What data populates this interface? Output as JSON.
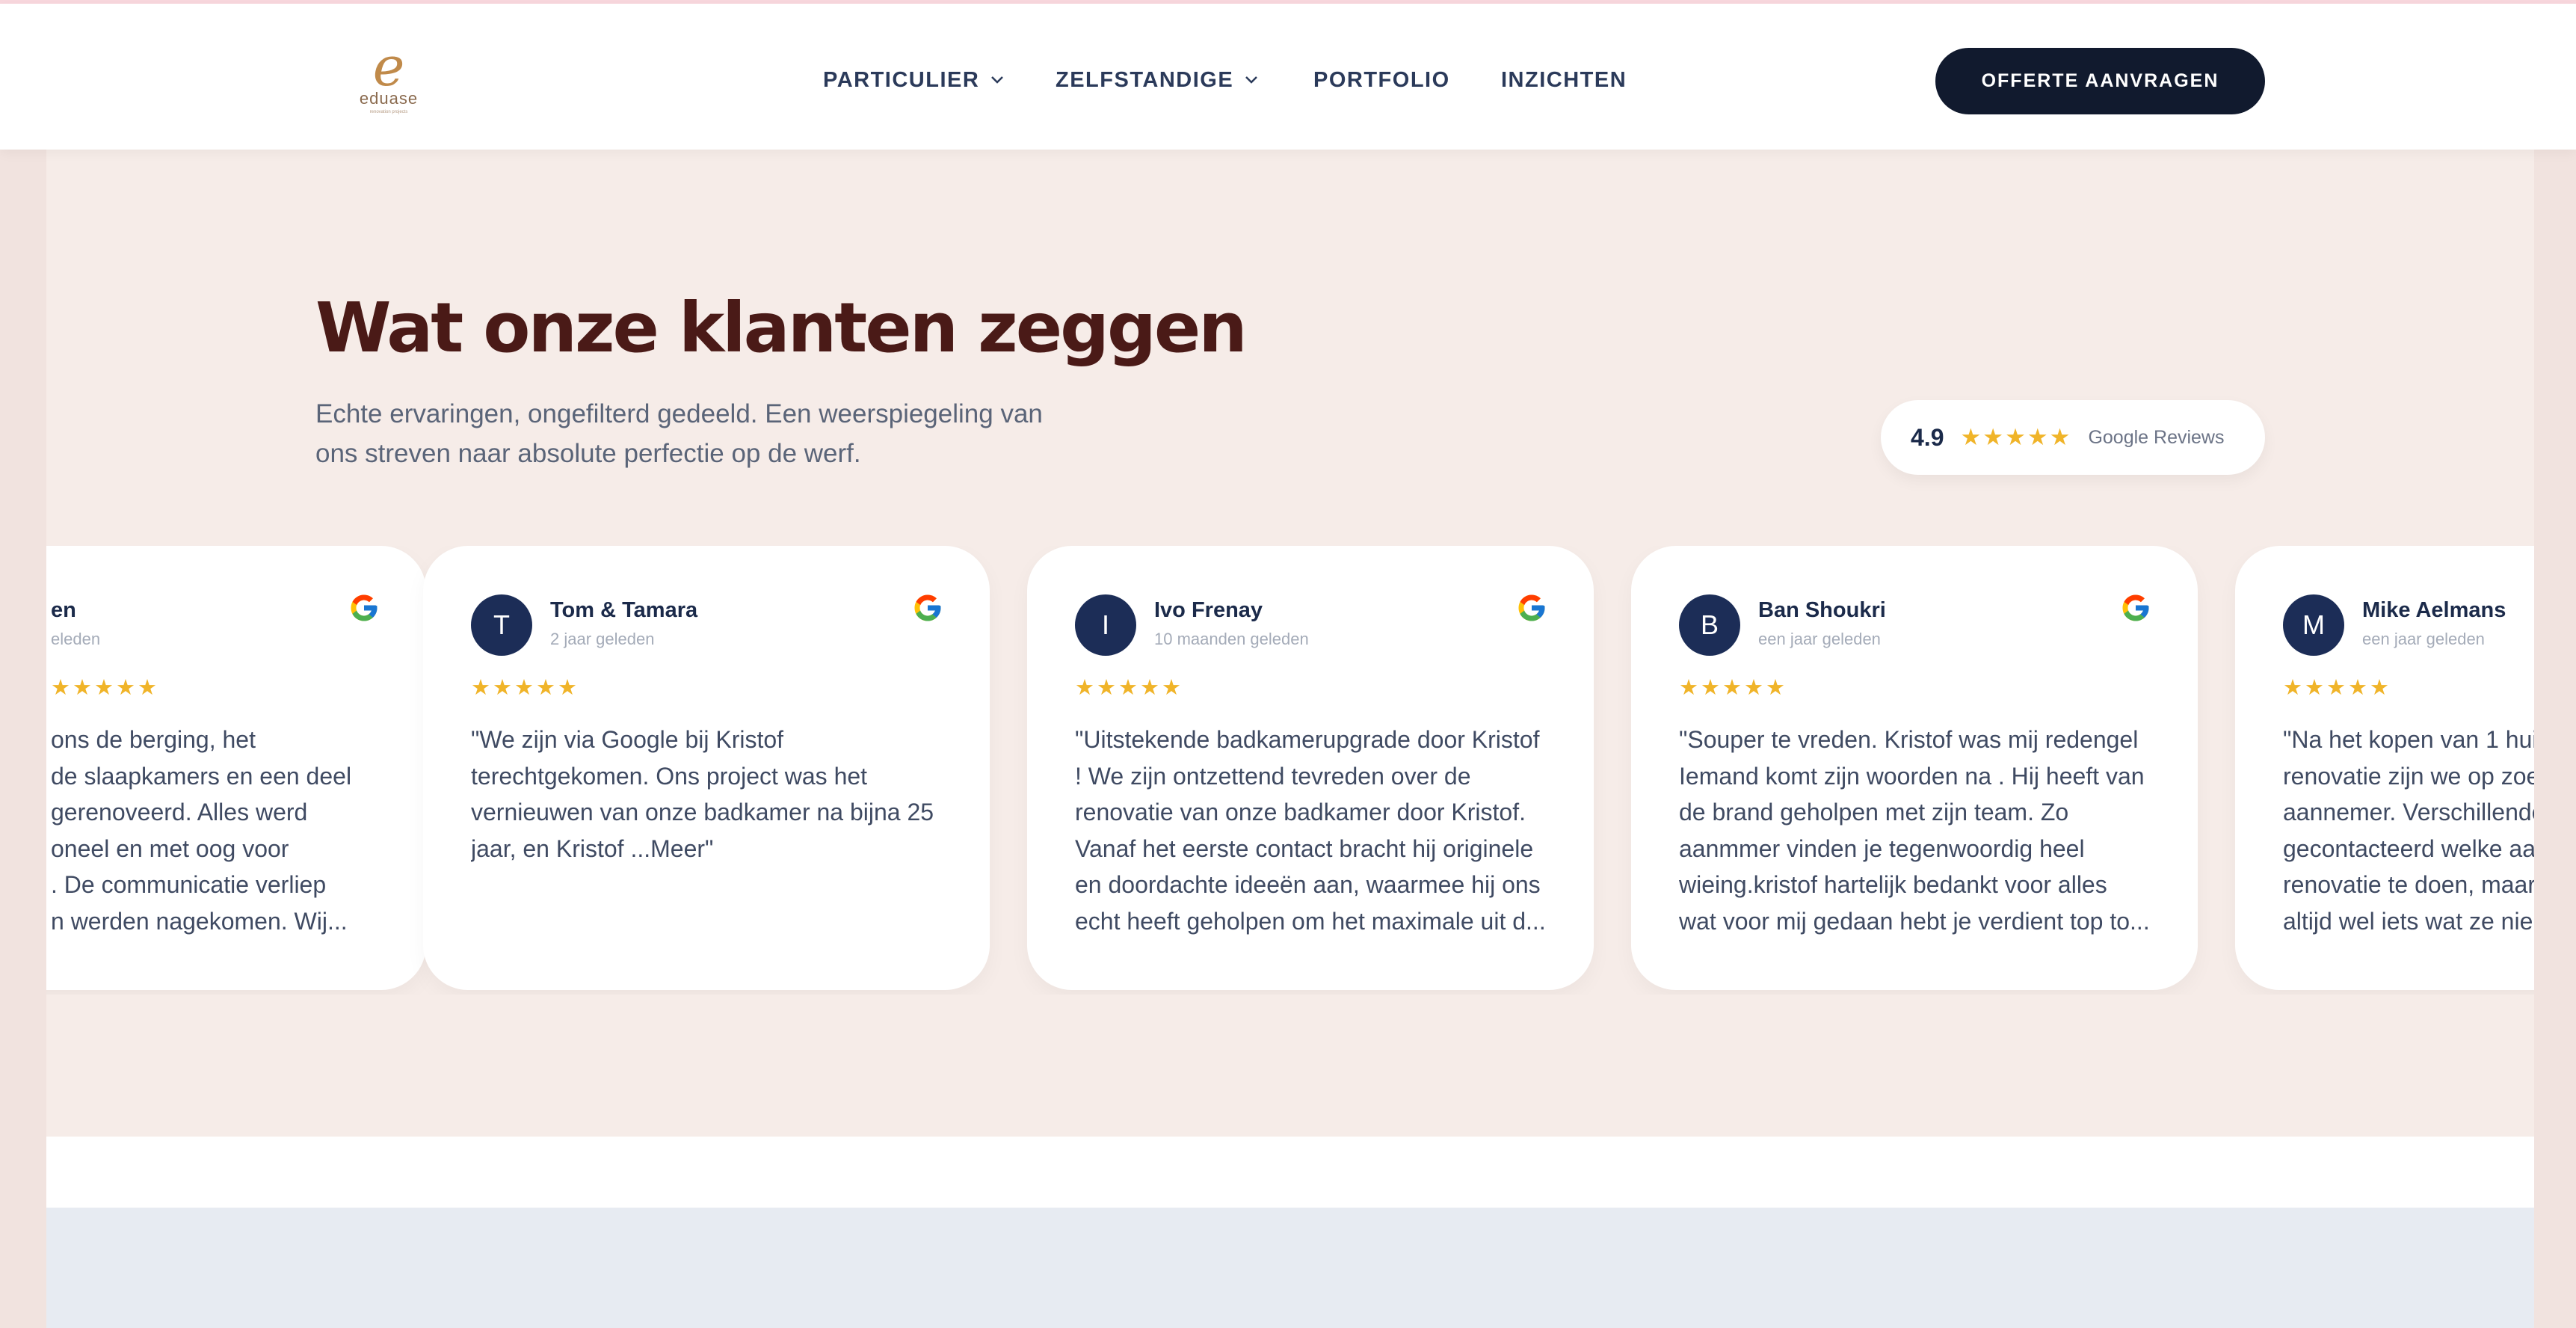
{
  "header": {
    "logo": {
      "mark": "e",
      "word": "eduase",
      "tagline": "renovation projects"
    },
    "nav": [
      {
        "label": "PARTICULIER",
        "dropdown": true
      },
      {
        "label": "ZELFSTANDIGE",
        "dropdown": true
      },
      {
        "label": "PORTFOLIO",
        "dropdown": false
      },
      {
        "label": "INZICHTEN",
        "dropdown": false
      }
    ],
    "cta_label": "OFFERTE AANVRAGEN"
  },
  "section": {
    "title": "Wat onze klanten zeggen",
    "subtitle": "Echte ervaringen, ongefilterd gedeeld. Een weerspiegeling van ons streven naar absolute perfectie op de werf."
  },
  "rating": {
    "score": "4.9",
    "stars": "★★★★★",
    "source": "Google Reviews"
  },
  "reviews": [
    {
      "initial": "",
      "name": "en",
      "time": "eleden",
      "stars": "★★★★★",
      "lines": [
        "ons de berging, het",
        "de slaapkamers en een deel",
        "gerenoveerd. Alles werd",
        "oneel en met oog voor",
        ". De communicatie verliep",
        "n werden nagekomen. Wij..."
      ]
    },
    {
      "initial": "T",
      "name": "Tom & Tamara",
      "time": "2 jaar geleden",
      "stars": "★★★★★",
      "lines": [
        "\"We zijn via Google bij Kristof",
        "terechtgekomen. Ons project was het",
        "vernieuwen van onze badkamer na bijna 25",
        "jaar, en Kristof ...Meer\""
      ]
    },
    {
      "initial": "I",
      "name": "Ivo Frenay",
      "time": "10 maanden geleden",
      "stars": "★★★★★",
      "lines": [
        "\"Uitstekende badkamerupgrade door Kristof",
        "! We zijn ontzettend tevreden over de",
        "renovatie van onze badkamer door Kristof.",
        "Vanaf het eerste contact bracht hij originele",
        "en doordachte ideeën aan, waarmee hij ons",
        "echt heeft geholpen om het maximale uit d..."
      ]
    },
    {
      "initial": "B",
      "name": "Ban Shoukri",
      "time": "een jaar geleden",
      "stars": "★★★★★",
      "lines": [
        "\"Souper te vreden. Kristof was mij redengel",
        "Iemand komt zijn woorden na . Hij heeft van",
        "de brand geholpen met zijn team. Zo",
        "aanmmer vinden je tegenwoordig heel",
        "wieing.kristof hartelijk bedankt voor alles",
        "wat voor mij gedaan hebt je verdient top to..."
      ]
    },
    {
      "initial": "M",
      "name": "Mike Aelmans",
      "time": "een jaar geleden",
      "stars": "★★★★★",
      "lines": [
        "\"Na het kopen van 1 huis",
        "renovatie zijn we op zoe",
        "aannemer. Verschillende",
        "gecontacteerd welke aa",
        "renovatie te doen, maar",
        "altijd wel iets wat ze nie"
      ]
    }
  ]
}
